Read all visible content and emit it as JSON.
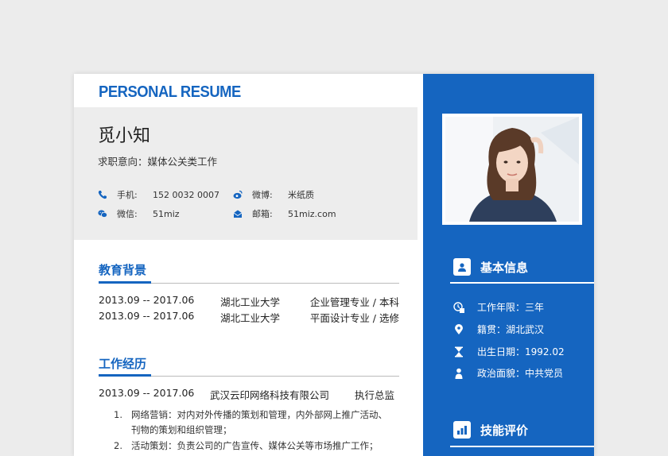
{
  "brand": "PERSONAL RESUME",
  "name": "觅小知",
  "intent": "求职意向：媒体公关类工作",
  "contacts": [
    {
      "icon": "phone-icon",
      "label": "手机:",
      "value": "152 0032 0007"
    },
    {
      "icon": "weibo-icon",
      "label": "微博:",
      "value": "米纸质"
    },
    {
      "icon": "wechat-icon",
      "label": "微信:",
      "value": "51miz"
    },
    {
      "icon": "mail-icon",
      "label": "邮箱:",
      "value": "51miz.com"
    }
  ],
  "education": {
    "title": "教育背景",
    "rows": [
      {
        "date": "2013.09 -- 2017.06",
        "school": "湖北工业大学",
        "major": "企业管理专业 / 本科"
      },
      {
        "date": "2013.09 -- 2017.06",
        "school": "湖北工业大学",
        "major": "平面设计专业 / 选修"
      }
    ]
  },
  "work": {
    "title": "工作经历",
    "row": {
      "date": "2013.09 -- 2017.06",
      "company": "武汉云印网络科技有限公司",
      "role": "执行总监"
    },
    "items": [
      {
        "num": "1.",
        "text": "网络营销：对内对外传播的策划和管理，内外部网上推广活动、刊物的策划和组织管理；"
      },
      {
        "num": "2.",
        "text": "活动策划：负责公司的广告宣传、媒体公关等市场推广工作；"
      }
    ]
  },
  "basic": {
    "title": "基本信息",
    "items": [
      {
        "icon": "work-years-icon",
        "text": "工作年限：三年"
      },
      {
        "icon": "location-pin-icon",
        "text": "籍贯：湖北武汉"
      },
      {
        "icon": "hourglass-icon",
        "text": "出生日期：1992.02"
      },
      {
        "icon": "person-icon",
        "text": "政治面貌：中共党员"
      }
    ]
  },
  "skills": {
    "title": "技能评价"
  },
  "colors": {
    "accent": "#1565c0",
    "panel": "#ededed"
  }
}
